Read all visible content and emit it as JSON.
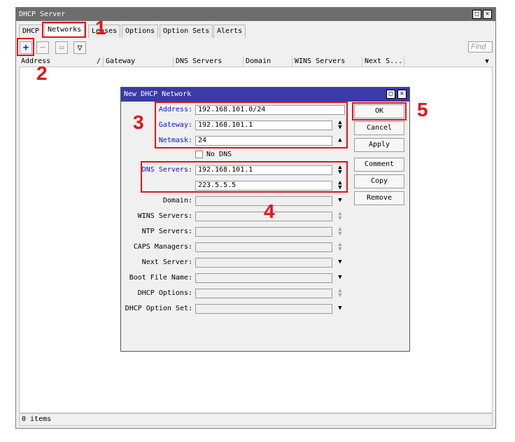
{
  "window": {
    "title": "DHCP Server"
  },
  "tabs": [
    "DHCP",
    "Networks",
    "Leases",
    "Options",
    "Option Sets",
    "Alerts"
  ],
  "toolbar": {
    "find_placeholder": "Find"
  },
  "columns": [
    "Address",
    "/",
    "Gateway",
    "DNS Servers",
    "Domain",
    "WINS Servers",
    "Next S..."
  ],
  "status": {
    "items": "0 items"
  },
  "annotations": [
    "1",
    "2",
    "3",
    "4",
    "5"
  ],
  "dialog": {
    "title": "New DHCP Network",
    "fields": {
      "address": {
        "label": "Address:",
        "value": "192.168.101.0/24"
      },
      "gateway": {
        "label": "Gateway:",
        "value": "192.168.101.1"
      },
      "netmask": {
        "label": "Netmask:",
        "value": "24"
      },
      "no_dns": {
        "label": "No DNS",
        "checked": false
      },
      "dns_servers": {
        "label": "DNS Servers:",
        "values": [
          "192.168.101.1",
          "223.5.5.5"
        ]
      },
      "domain": {
        "label": "Domain:",
        "value": ""
      },
      "wins_servers": {
        "label": "WINS Servers:",
        "value": ""
      },
      "ntp_servers": {
        "label": "NTP Servers:",
        "value": ""
      },
      "caps_managers": {
        "label": "CAPS Managers:",
        "value": ""
      },
      "next_server": {
        "label": "Next Server:",
        "value": ""
      },
      "boot_file_name": {
        "label": "Boot File Name:",
        "value": ""
      },
      "dhcp_options": {
        "label": "DHCP Options:",
        "value": ""
      },
      "dhcp_option_set": {
        "label": "DHCP Option Set:",
        "value": ""
      }
    },
    "buttons": {
      "ok": "OK",
      "cancel": "Cancel",
      "apply": "Apply",
      "comment": "Comment",
      "copy": "Copy",
      "remove": "Remove"
    }
  },
  "colors": {
    "title_bar": "#6d6d6d",
    "dialog_title_bar": "#3a3aa8",
    "annotation_red": "#e0141c",
    "field_label_blue": "#1010d0"
  }
}
